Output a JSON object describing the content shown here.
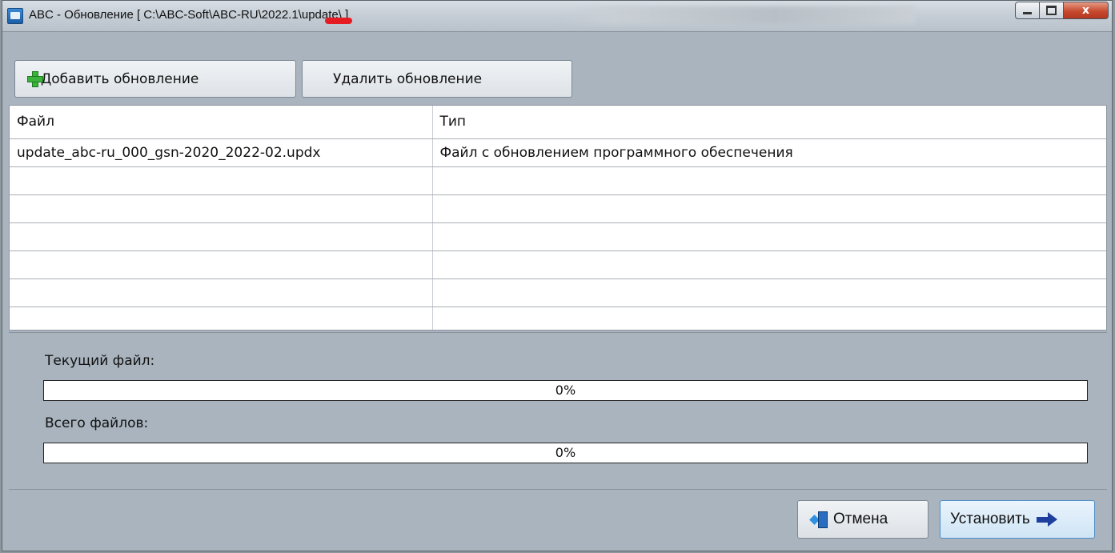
{
  "window": {
    "title": "ABC - Обновление [ C:\\ABC-Soft\\ABC-RU\\2022.1\\update\\ ]",
    "min_label": "",
    "max_label": "",
    "close_label": "x"
  },
  "toolbar": {
    "add_label": "Добавить обновление",
    "remove_label": "Удалить обновление"
  },
  "table": {
    "columns": [
      "Файл",
      "Тип"
    ],
    "rows": [
      [
        "update_abc-ru_000_gsn-2020_2022-02.updx",
        "Файл с обновлением программного обеспечения"
      ],
      [
        "",
        ""
      ],
      [
        "",
        ""
      ],
      [
        "",
        ""
      ],
      [
        "",
        ""
      ],
      [
        "",
        ""
      ],
      [
        "",
        ""
      ]
    ]
  },
  "progress": {
    "current_label": "Текущий файл:",
    "current_percent": 0,
    "current_text": "0%",
    "total_label": "Всего файлов:",
    "total_percent": 0,
    "total_text": "0%"
  },
  "buttons": {
    "cancel_label": "Отмена",
    "install_label": "Установить"
  },
  "colors": {
    "window_bg": "#a9b4be",
    "progress_fill": "#3d8ee0",
    "close_button": "#c84a2f"
  }
}
